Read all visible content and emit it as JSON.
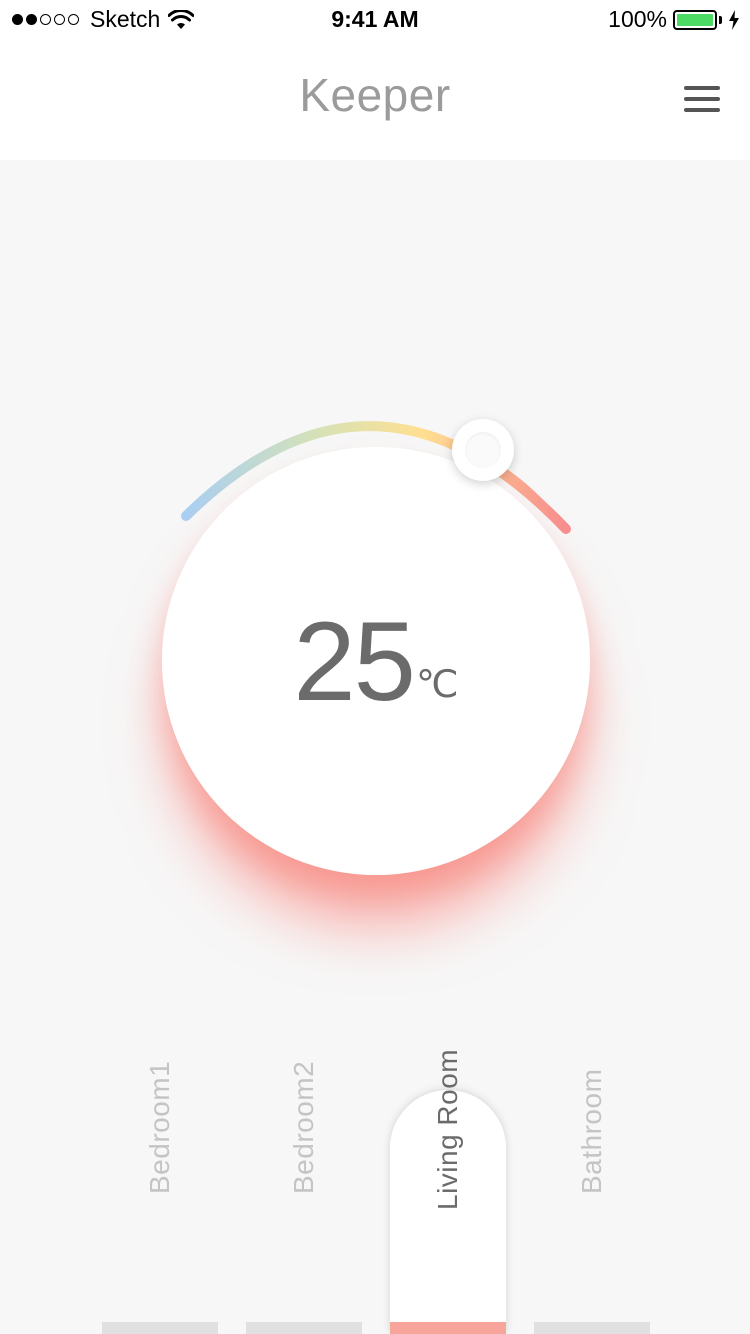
{
  "status_bar": {
    "carrier": "Sketch",
    "time": "9:41 AM",
    "battery_percent": "100%",
    "signal_bars_filled": 2,
    "signal_bars_total": 5
  },
  "header": {
    "title": "Keeper",
    "menu_icon": "hamburger-menu-icon"
  },
  "thermostat": {
    "temperature": "25",
    "unit": "℃",
    "arc_gradient": [
      "#a9cff2",
      "#d6e2b6",
      "#ffdf91",
      "#f78f90"
    ]
  },
  "rooms": [
    {
      "label": "Bedroom1",
      "active": false
    },
    {
      "label": "Bedroom2",
      "active": false
    },
    {
      "label": "Living Room",
      "active": true
    },
    {
      "label": "Bathroom",
      "active": false
    }
  ],
  "colors": {
    "accent": "#f7a59b",
    "glow": "#fa6e64",
    "battery": "#4cd964",
    "text_muted": "#9b9b9b"
  }
}
